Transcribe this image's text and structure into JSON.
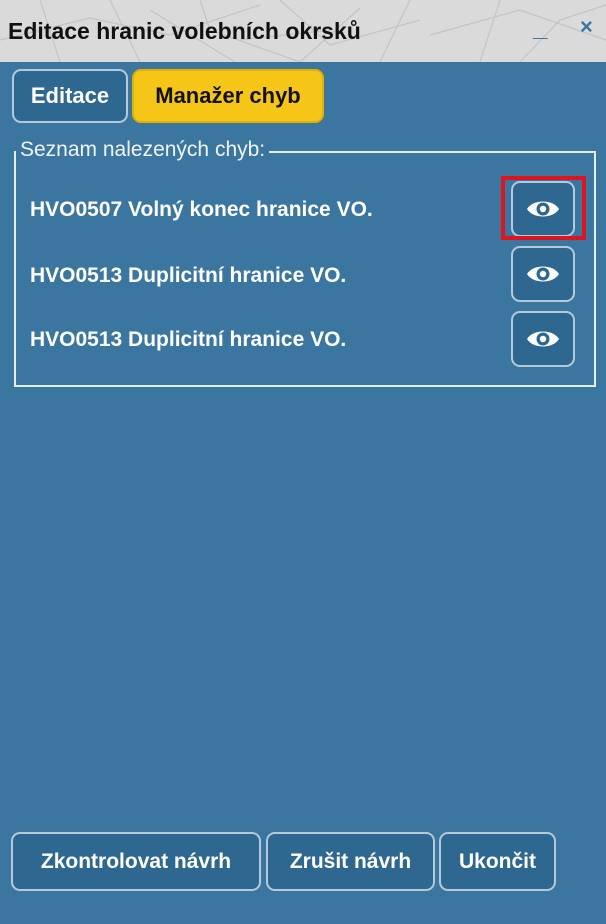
{
  "window": {
    "title": "Editace hranic volebních okrsků",
    "minimize_label": "_",
    "close_label": "×"
  },
  "tabs": [
    {
      "label": "Editace",
      "active": false
    },
    {
      "label": "Manažer chyb",
      "active": true
    }
  ],
  "error_list": {
    "legend": "Seznam nalezených chyb:",
    "items": [
      {
        "label": "HVO0507 Volný konec hranice VO.",
        "highlighted": true
      },
      {
        "label": "HVO0513 Duplicitní hranice VO.",
        "highlighted": false
      },
      {
        "label": "HVO0513 Duplicitní hranice VO.",
        "highlighted": false
      }
    ],
    "action_icon": "eye-icon"
  },
  "footer": {
    "check_label": "Zkontrolovat návrh",
    "cancel_label": "Zrušit návrh",
    "exit_label": "Ukončit"
  },
  "colors": {
    "panel_background": "#3b76a1",
    "button_background": "#2e6890",
    "active_tab": "#f5c518",
    "highlight": "#e0141c",
    "title_bar": "#dadada"
  }
}
